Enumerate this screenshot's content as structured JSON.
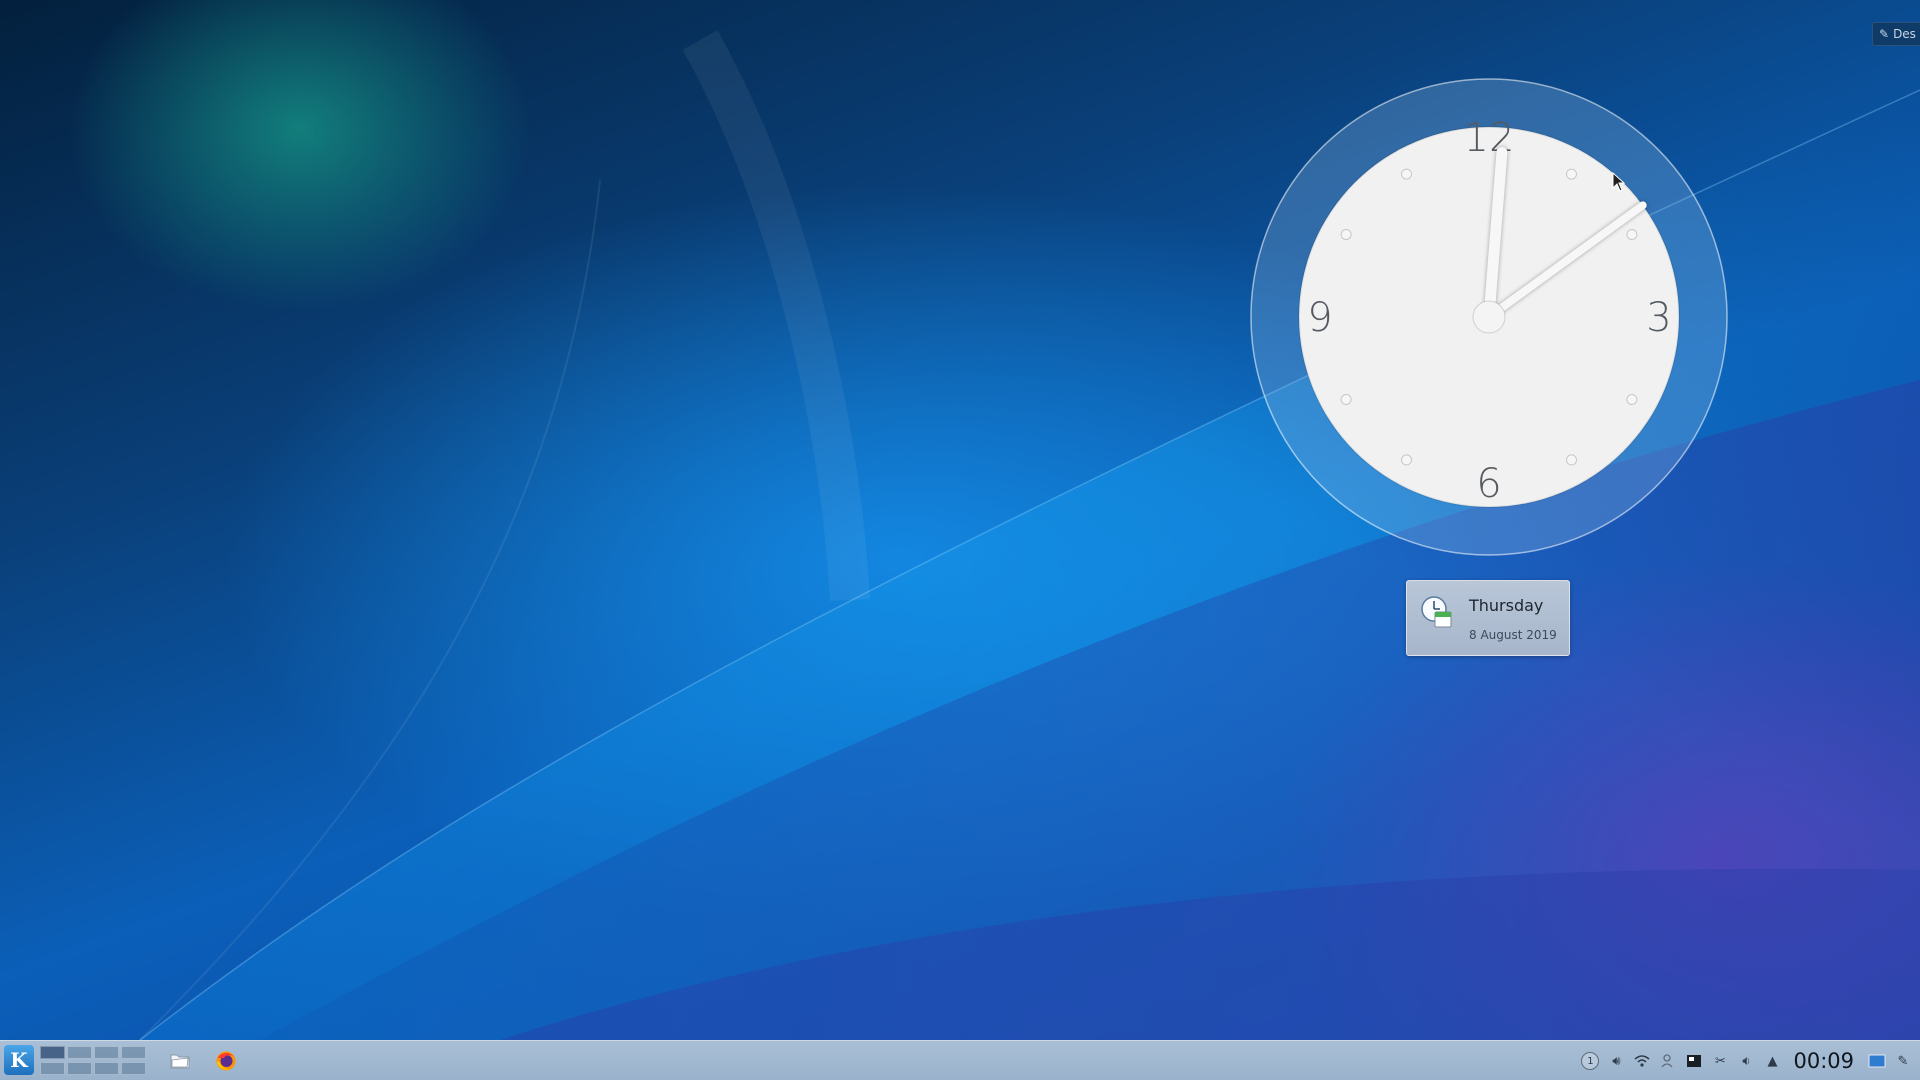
{
  "desktop": {
    "toolbox_label": "Des",
    "toolbox_icon": "wrench-icon"
  },
  "clock": {
    "type": "analog",
    "numerals": [
      "12",
      "3",
      "6",
      "9"
    ],
    "time": "00:09",
    "hour_hand_degrees": 4.5,
    "minute_hand_degrees": 54
  },
  "date": {
    "day": "Thursday",
    "full": "8 August 2019",
    "icon": "calendar-clock-icon"
  },
  "panel": {
    "launcher_label": "K",
    "virtual_desktops": 8,
    "active_desktop": 1,
    "launchers": [
      {
        "name": "files",
        "icon": "folder-icon"
      },
      {
        "name": "browser",
        "icon": "firefox-icon"
      }
    ],
    "tray": {
      "notification_count": "1",
      "clock": "00:09"
    }
  },
  "colors": {
    "panel": "#a8bfd6",
    "accent": "#1e6fbd"
  }
}
